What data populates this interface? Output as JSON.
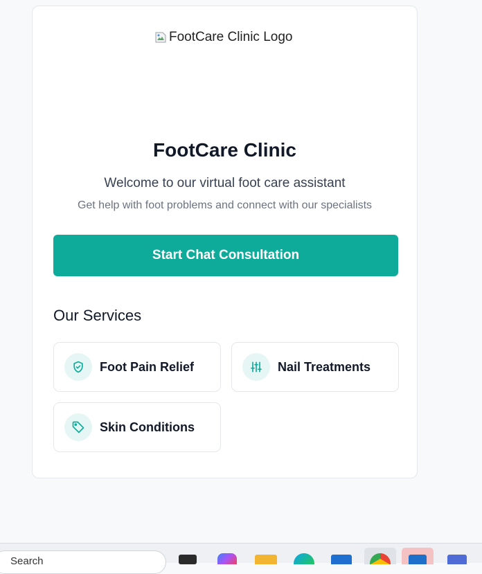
{
  "logo": {
    "alt": "FootCare Clinic Logo"
  },
  "clinic": {
    "name": "FootCare Clinic",
    "welcome": "Welcome to our virtual foot care assistant",
    "tagline": "Get help with foot problems and connect with our specialists"
  },
  "cta": {
    "label": "Start Chat Consultation"
  },
  "services": {
    "heading": "Our Services",
    "items": [
      {
        "label": "Foot Pain Relief",
        "icon": "shield-check-icon"
      },
      {
        "label": "Nail Treatments",
        "icon": "sliders-icon"
      },
      {
        "label": "Skin Conditions",
        "icon": "tag-icon"
      }
    ]
  },
  "taskbar": {
    "search_placeholder": "Search"
  },
  "colors": {
    "accent": "#0eaa9a",
    "icon_bg": "#e6f6f4",
    "text": "#111827"
  }
}
